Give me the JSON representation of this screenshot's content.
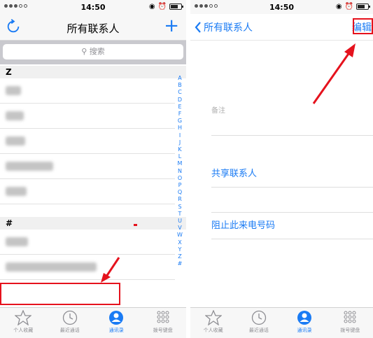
{
  "status": {
    "time": "14:50",
    "alarm_icon": "⏰"
  },
  "left": {
    "title": "所有联系人",
    "add_label": "+",
    "search_placeholder": "搜索",
    "sections": [
      {
        "letter": "Z"
      },
      {
        "letter": "#"
      }
    ],
    "index_letters": [
      "A",
      "B",
      "C",
      "D",
      "E",
      "F",
      "G",
      "H",
      "I",
      "J",
      "K",
      "L",
      "M",
      "N",
      "O",
      "P",
      "Q",
      "R",
      "S",
      "T",
      "U",
      "V",
      "W",
      "X",
      "Y",
      "Z",
      "#"
    ]
  },
  "right": {
    "back_label": "所有联系人",
    "edit_label": "编辑",
    "note_label": "备注",
    "share_label": "共享联系人",
    "block_label": "阻止此来电号码"
  },
  "tabs": [
    {
      "label": "个人收藏",
      "icon": "star-icon",
      "active": false
    },
    {
      "label": "最近通话",
      "icon": "clock-icon",
      "active": false
    },
    {
      "label": "通讯录",
      "icon": "contacts-icon",
      "active": true
    },
    {
      "label": "拨号键盘",
      "icon": "keypad-icon",
      "active": false
    }
  ],
  "colors": {
    "accent": "#1a7bf4",
    "annotation_red": "#e5121d"
  }
}
